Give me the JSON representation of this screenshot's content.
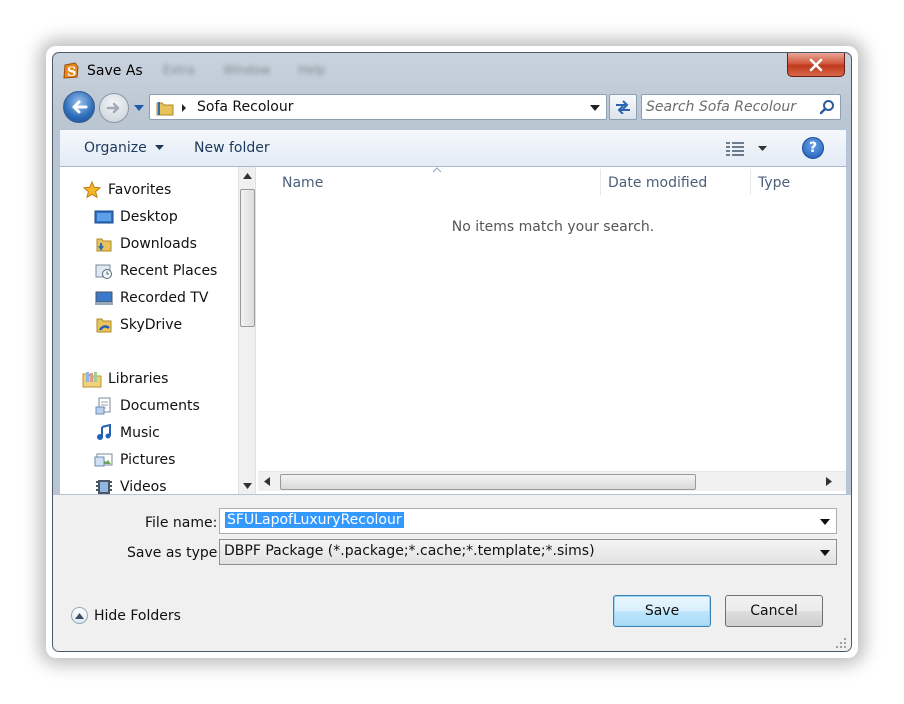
{
  "window": {
    "title": "Save As",
    "app_icon": "sims-s-icon",
    "background_menu": [
      "Extra",
      "Window",
      "Help"
    ]
  },
  "navbar": {
    "path": "Sofa Recolour",
    "search_placeholder": "Search Sofa Recolour"
  },
  "toolbar": {
    "organize_label": "Organize",
    "new_folder_label": "New folder",
    "help_glyph": "?"
  },
  "nav_pane": {
    "favorites_label": "Favorites",
    "favorites": [
      {
        "label": "Desktop",
        "icon": "desktop-icon"
      },
      {
        "label": "Downloads",
        "icon": "downloads-folder-icon"
      },
      {
        "label": "Recent Places",
        "icon": "recent-places-icon"
      },
      {
        "label": "Recorded TV",
        "icon": "recorded-tv-icon"
      },
      {
        "label": "SkyDrive",
        "icon": "skydrive-icon"
      }
    ],
    "libraries_label": "Libraries",
    "libraries": [
      {
        "label": "Documents",
        "icon": "documents-icon"
      },
      {
        "label": "Music",
        "icon": "music-icon"
      },
      {
        "label": "Pictures",
        "icon": "pictures-icon"
      },
      {
        "label": "Videos",
        "icon": "videos-icon"
      }
    ]
  },
  "file_list": {
    "columns": [
      "Name",
      "Date modified",
      "Type"
    ],
    "empty_message": "No items match your search."
  },
  "form": {
    "file_name_label": "File name:",
    "file_name_value": "SFULapofLuxuryRecolour",
    "save_type_label": "Save as type:",
    "save_type_value": "DBPF Package (*.package;*.cache;*.template;*.sims)"
  },
  "footer": {
    "hide_folders_label": "Hide Folders",
    "save_label": "Save",
    "cancel_label": "Cancel"
  },
  "colors": {
    "accent_blue": "#3399ff",
    "close_red": "#c0381c",
    "link_text": "#1e395b"
  }
}
